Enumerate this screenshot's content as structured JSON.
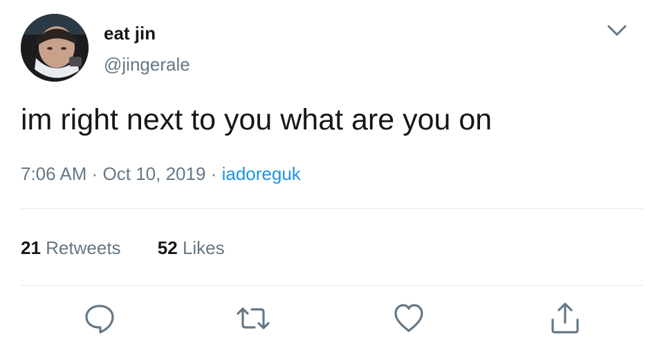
{
  "user": {
    "display_name": "eat jin",
    "handle": "@jingerale",
    "avatar_icon": "profile-photo"
  },
  "tweet": {
    "text": "im right next to you what are you on",
    "time": "7:06 AM",
    "date": "Oct 10, 2019",
    "separator": "·",
    "source": "iadoreguk"
  },
  "stats": {
    "retweets_count": "21",
    "retweets_label": "Retweets",
    "likes_count": "52",
    "likes_label": "Likes"
  },
  "actions": {
    "reply_icon": "speech-bubble",
    "retweet_icon": "retweet-arrows",
    "like_icon": "heart",
    "share_icon": "share-upload"
  },
  "colors": {
    "text_primary": "#14171a",
    "text_secondary": "#657786",
    "link": "#1b95e0",
    "divider": "#e1e8ed"
  }
}
